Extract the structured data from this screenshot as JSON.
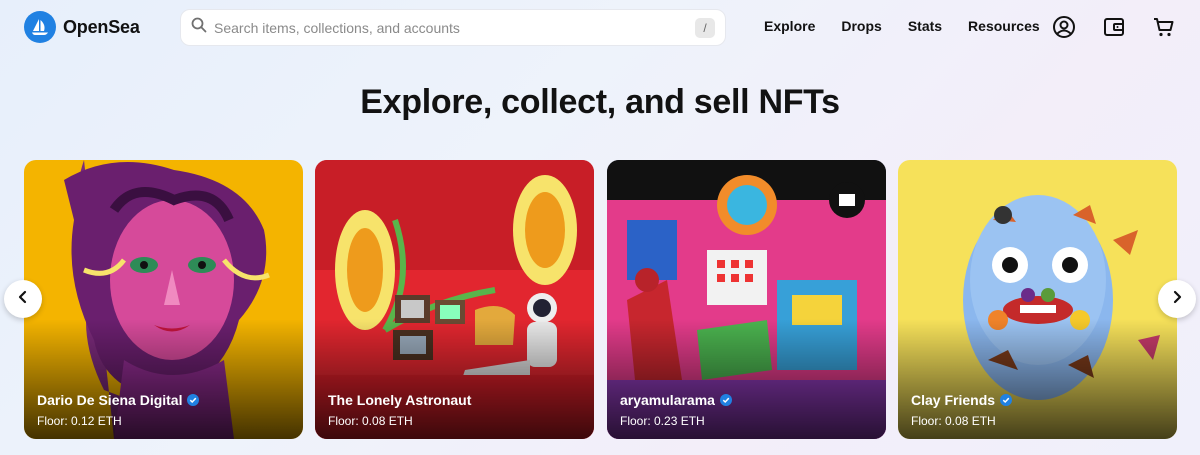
{
  "brand": {
    "name": "OpenSea"
  },
  "search": {
    "placeholder": "Search items, collections, and accounts",
    "shortcut": "/"
  },
  "nav": {
    "links": [
      {
        "label": "Explore"
      },
      {
        "label": "Drops"
      },
      {
        "label": "Stats"
      },
      {
        "label": "Resources"
      }
    ],
    "icons": [
      "account-icon",
      "wallet-icon",
      "cart-icon"
    ]
  },
  "hero": {
    "title": "Explore, collect, and sell NFTs"
  },
  "carousel": {
    "prev_icon": "chevron-left-icon",
    "next_icon": "chevron-right-icon",
    "items": [
      {
        "name": "Dario De Siena Digital",
        "verified": true,
        "floor": "Floor: 0.12 ETH"
      },
      {
        "name": "The Lonely Astronaut",
        "verified": false,
        "floor": "Floor: 0.08 ETH"
      },
      {
        "name": "aryamularama",
        "verified": true,
        "floor": "Floor: 0.23 ETH"
      },
      {
        "name": "Clay Friends",
        "verified": true,
        "floor": "Floor: 0.08 ETH"
      }
    ]
  },
  "colors": {
    "brand_blue": "#2081e2",
    "verified_blue": "#2081e2",
    "text": "#121212"
  }
}
